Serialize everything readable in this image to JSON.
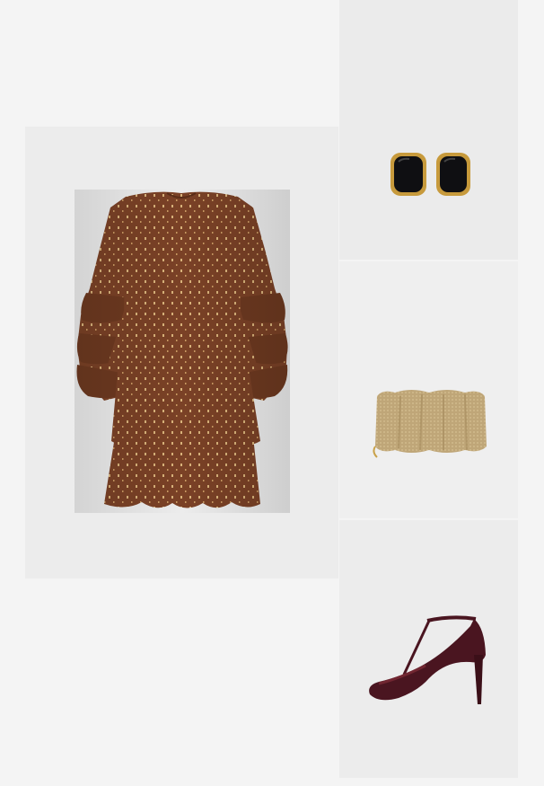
{
  "collage": {
    "items": [
      {
        "id": "dress",
        "kind": "tiered ruffle mini dress",
        "color": "#7a4126",
        "accent": "#d8b27a"
      },
      {
        "id": "earrings",
        "kind": "black enamel square stud earrings",
        "color": "#0f0f12",
        "accent": "#c79a3c"
      },
      {
        "id": "clutch",
        "kind": "gold mesh pleated clutch",
        "color": "#bfa678",
        "accent": "#d1ba8c"
      },
      {
        "id": "heels",
        "kind": "burgundy patent t-strap pumps",
        "color": "#4a1520",
        "accent": "#7a2a36"
      }
    ],
    "background": "#f4f4f4"
  }
}
